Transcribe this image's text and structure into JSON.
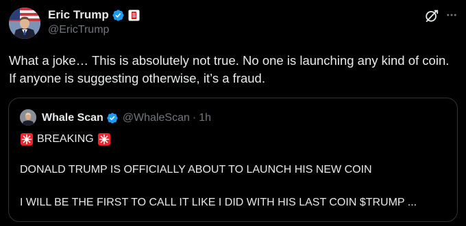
{
  "author": {
    "name": "Eric Trump",
    "handle": "@EricTrump",
    "avatar_icon": "avatar-photo",
    "verified_color": "#1d9bf0",
    "affiliate_badge_icon": "affiliate-badge-icon"
  },
  "header_actions": {
    "grok_icon": "grok-icon",
    "more_icon": "more-horizontal-icon"
  },
  "post": {
    "text": "What a joke… This is absolutely not true. No one is launching any kind of coin. If anyone is suggesting otherwise, it’s a fraud."
  },
  "quote": {
    "name": "Whale Scan",
    "handle": "@WhaleScan",
    "separator": "·",
    "time": "1h",
    "line1": "BREAKING",
    "line2": "DONALD TRUMP IS OFFICIALLY ABOUT TO LAUNCH HIS NEW COIN",
    "line3": "I WILL BE THE FIRST TO CALL IT LIKE I DID WITH HIS LAST COIN $TRUMP ..."
  },
  "colors": {
    "background": "#000000",
    "text_primary": "#e7e9ea",
    "text_secondary": "#71767b",
    "border": "#2f3336",
    "verified": "#1d9bf0",
    "siren": "#f4212e"
  }
}
